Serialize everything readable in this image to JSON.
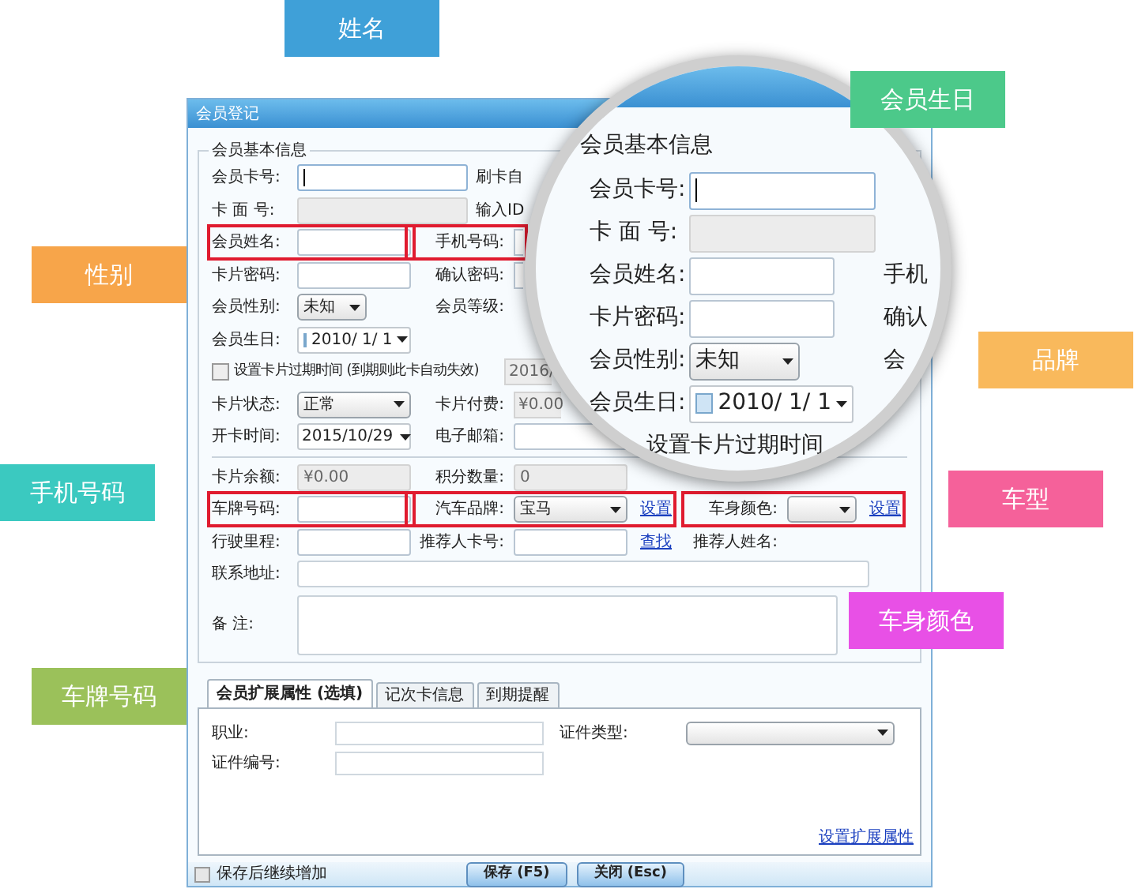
{
  "dialog": {
    "title": "会员登记",
    "group_title": "会员基本信息",
    "rows": [
      [
        {
          "label": "会员卡号:",
          "kind": "wide_focus"
        },
        {
          "label": "刷卡自"
        }
      ],
      [
        {
          "label": "卡 面 号:",
          "kind": "wide_disabled"
        },
        {
          "label": "输入ID"
        }
      ],
      [
        {
          "label": "会员姓名:",
          "kind": "input",
          "highlighted": true
        },
        {
          "label": "手机号码:",
          "kind": "stub_input",
          "highlighted": true
        }
      ],
      [
        {
          "label": "卡片密码:",
          "kind": "input"
        },
        {
          "label": "确认密码:",
          "kind": "stub_input"
        }
      ],
      [
        {
          "label": "会员性别:",
          "kind": "small_select",
          "value": "未知"
        },
        {
          "label": "会员等级:"
        }
      ],
      [
        {
          "label": "会员生日:",
          "kind": "date",
          "value": "2010/ 1/ 1"
        }
      ],
      [
        {
          "kind": "check",
          "label": "设置卡片过期时间 (到期则此卡自动失效)",
          "checked": false
        },
        {
          "kind": "stub_disabled",
          "value": "2016/"
        }
      ],
      [
        {
          "label": "卡片状态:",
          "kind": "select",
          "value": "正常"
        },
        {
          "label": "卡片付费:",
          "kind": "stub_disabled",
          "value": "¥0.00"
        }
      ],
      [
        {
          "label": "开卡时间:",
          "kind": "calendar",
          "value": "2015/10/29"
        },
        {
          "label": "电子邮箱:",
          "kind": "input"
        }
      ],
      [
        {
          "label": "卡片余额:",
          "kind": "disabled",
          "value": "¥0.00"
        },
        {
          "label": "积分数量:",
          "kind": "disabled",
          "value": "0"
        }
      ],
      [
        {
          "label": "车牌号码:",
          "kind": "input",
          "highlighted": true
        },
        {
          "label": "汽车品牌:",
          "kind": "select",
          "value": "宝马",
          "link": "设置",
          "highlighted": true
        },
        {
          "label": "车身颜色:",
          "kind": "small_select",
          "link": "设置",
          "highlighted": true
        }
      ],
      [
        {
          "label": "行驶里程:",
          "kind": "input"
        },
        {
          "label": "推荐人卡号:",
          "kind": "input",
          "link": "查找"
        },
        {
          "label": "推荐人姓名:"
        }
      ],
      [
        {
          "label": "联系地址:",
          "kind": "long_input"
        }
      ],
      [
        {
          "label": "备 注:",
          "kind": "textarea"
        }
      ]
    ],
    "tabs": [
      {
        "label": "会员扩展属性 (选填)",
        "selected": true
      },
      {
        "label": "记次卡信息",
        "selected": false
      },
      {
        "label": "到期提醒",
        "selected": false
      }
    ],
    "tab_rows": [
      [
        {
          "label": "职业:",
          "kind": "input"
        },
        {
          "label": "证件类型:",
          "kind": "select"
        }
      ],
      [
        {
          "label": "证件编号:",
          "kind": "input"
        }
      ]
    ],
    "tab_link": "设置扩展属性",
    "keep_adding": {
      "label": "保存后继续增加",
      "checked": false
    },
    "buttons": [
      "保存 (F5)",
      "关闭 (Esc)"
    ]
  },
  "magnifier": {
    "group_title": "会员基本信息",
    "rows": [
      {
        "label": "会员卡号:",
        "kind": "wide_focus"
      },
      {
        "label": "卡 面 号:",
        "kind": "wide_disabled"
      },
      {
        "label": "会员姓名:",
        "kind": "input",
        "right_label": "手机"
      },
      {
        "label": "卡片密码:",
        "kind": "input",
        "right_label": "确认"
      },
      {
        "label": "会员性别:",
        "kind": "select",
        "value": "未知",
        "right_label": "会"
      },
      {
        "label": "会员生日:",
        "kind": "date",
        "value": "2010/ 1/ 1"
      },
      {
        "kind": "text",
        "label": "设置卡片过期时间"
      }
    ]
  },
  "callouts": [
    {
      "text": "姓名",
      "color": "#3fa0d8"
    },
    {
      "text": "会员生日",
      "color": "#4cc98a"
    },
    {
      "text": "性别",
      "color": "#f7a54a"
    },
    {
      "text": "品牌",
      "color": "#f9b95c"
    },
    {
      "text": "手机号码",
      "color": "#3bc9c0"
    },
    {
      "text": "车型",
      "color": "#f5619a"
    },
    {
      "text": "车身颜色",
      "color": "#e850e6"
    },
    {
      "text": "车牌号码",
      "color": "#9bc15a"
    }
  ]
}
